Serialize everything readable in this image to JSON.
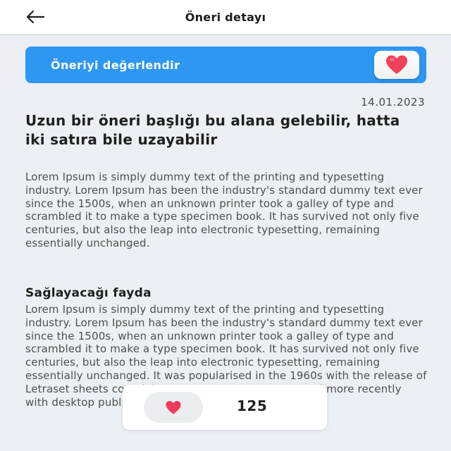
{
  "header": {
    "title": "Öneri detayı",
    "back_icon": "arrow-left-icon"
  },
  "rate_banner": {
    "label": "Öneriyi değerlendir",
    "icon": "heart-icon",
    "accent": "#2e97f1",
    "heart_color": "#f2425b"
  },
  "suggestion": {
    "date": "14.01.2023",
    "title": "Uzun bir öneri başlığı bu alana gelebilir, hatta iki satıra bile uzayabilir",
    "description": "Lorem Ipsum is simply dummy text of the printing and typesetting industry. Lorem Ipsum has been the industry's standard dummy text ever since the 1500s, when an unknown printer took a galley of type and scrambled it to make a type specimen book. It has survived not only five centuries, but also the leap into electronic typesetting, remaining essentially unchanged.",
    "benefit_heading": "Sağlayacağı fayda",
    "benefit_text": "Lorem Ipsum is simply dummy text of the printing and typesetting industry. Lorem Ipsum has been the industry's standard dummy text ever since the 1500s, when an unknown printer took a galley of type and scrambled it to make a type specimen book. It has survived not only five centuries, but also the leap into electronic typesetting, remaining essentially unchanged. It was popularised in the 1960s with the release of Letraset sheets containing Lorem Ipsum passages, and more recently with desktop publishing software like"
  },
  "likes": {
    "count": "125",
    "icon": "heart-icon",
    "heart_color": "#ee3a5b"
  }
}
